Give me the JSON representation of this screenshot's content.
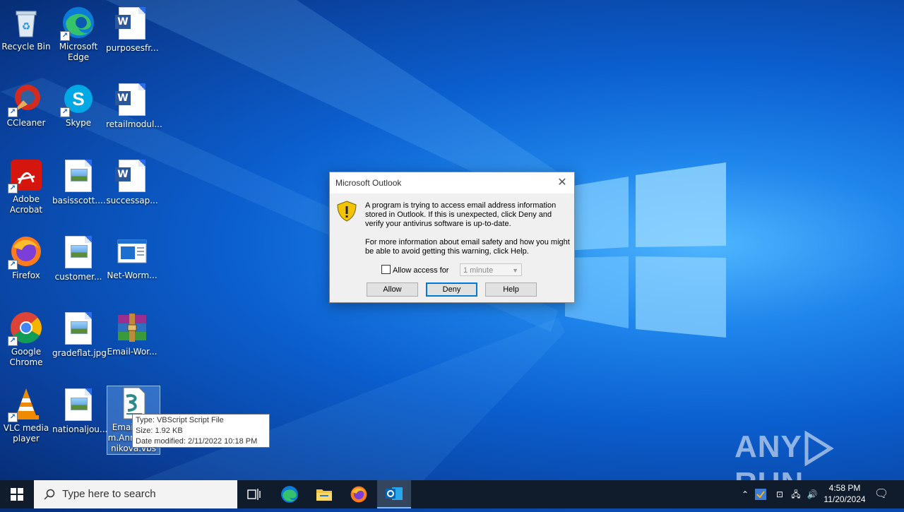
{
  "desktop": {
    "icons": [
      {
        "label": "Recycle Bin"
      },
      {
        "label": "Microsoft Edge"
      },
      {
        "label": "purposesfr..."
      },
      {
        "label": "CCleaner"
      },
      {
        "label": "Skype"
      },
      {
        "label": "retailmodul..."
      },
      {
        "label": "Adobe Acrobat"
      },
      {
        "label": "basisscott...."
      },
      {
        "label": "successap..."
      },
      {
        "label": "Firefox"
      },
      {
        "label": "customer..."
      },
      {
        "label": "Net-Worm..."
      },
      {
        "label": "Google Chrome"
      },
      {
        "label": "gradeflat.jpg"
      },
      {
        "label": "Email-Wor..."
      },
      {
        "label": "VLC media player"
      },
      {
        "label": "nationaljou..."
      },
      {
        "label": "Email-Worm.Annakournikova.vbs"
      }
    ]
  },
  "dialog": {
    "title": "Microsoft Outlook",
    "message1": "A program is trying to access email address information stored in Outlook. If this is unexpected, click Deny and verify your antivirus software is up-to-date.",
    "message2": "For more information about email safety and how you might be able to avoid getting this warning, click Help.",
    "allow_access_label": "Allow access for",
    "duration_value": "1 minute",
    "buttons": {
      "allow": "Allow",
      "deny": "Deny",
      "help": "Help"
    }
  },
  "tooltip": {
    "type": "Type: VBScript Script File",
    "size": "Size: 1.92 KB",
    "modified": "Date modified: 2/11/2022 10:18 PM"
  },
  "watermark": {
    "left": "ANY",
    "right": "RUN"
  },
  "taskbar": {
    "search_placeholder": "Type here to search",
    "time": "4:58 PM",
    "date": "11/20/2024"
  }
}
